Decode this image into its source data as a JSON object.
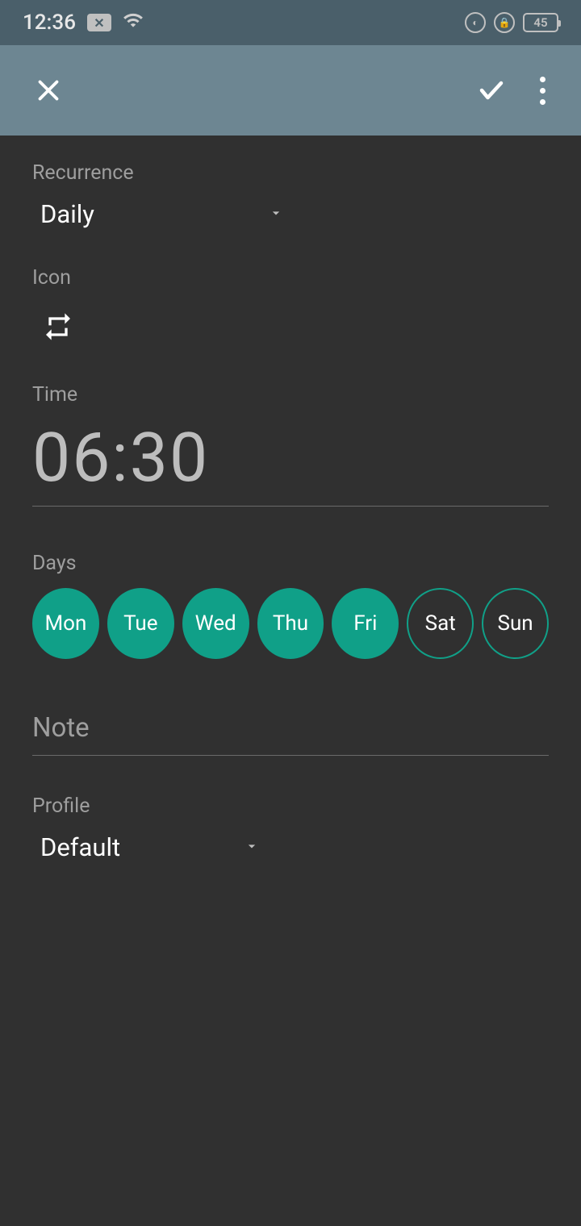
{
  "statusbar": {
    "time": "12:36",
    "battery": "45"
  },
  "sections": {
    "recurrence_label": "Recurrence",
    "recurrence_value": "Daily",
    "icon_label": "Icon",
    "time_label": "Time",
    "time_value": "06:30",
    "days_label": "Days",
    "note_label": "Note",
    "profile_label": "Profile",
    "profile_value": "Default"
  },
  "days": [
    {
      "label": "Mon",
      "selected": true
    },
    {
      "label": "Tue",
      "selected": true
    },
    {
      "label": "Wed",
      "selected": true
    },
    {
      "label": "Thu",
      "selected": true
    },
    {
      "label": "Fri",
      "selected": true
    },
    {
      "label": "Sat",
      "selected": false
    },
    {
      "label": "Sun",
      "selected": false
    }
  ],
  "colors": {
    "accent": "#10a088",
    "appbar": "#6d8692",
    "background": "#303030"
  }
}
